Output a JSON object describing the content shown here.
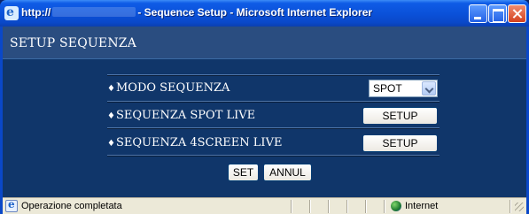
{
  "window": {
    "title_prefix": "http://",
    "title_suffix": "- Sequence Setup - Microsoft Internet Explorer"
  },
  "header": {
    "title": "SETUP SEQUENZA"
  },
  "rows": [
    {
      "label": "MODO SEQUENZA",
      "bullet": "♦"
    },
    {
      "label": "SEQUENZA SPOT LIVE",
      "bullet": "♦"
    },
    {
      "label": "SEQUENZA 4SCREEN LIVE",
      "bullet": "♦"
    }
  ],
  "mode_select": {
    "value": "SPOT"
  },
  "setup_buttons": [
    "SETUP",
    "SETUP"
  ],
  "actions": {
    "set": "SET",
    "cancel": "ANNUL"
  },
  "statusbar": {
    "status": "Operazione completata",
    "zone": "Internet"
  },
  "icons": {
    "app": "internet-explorer-icon",
    "zone": "globe-icon"
  }
}
